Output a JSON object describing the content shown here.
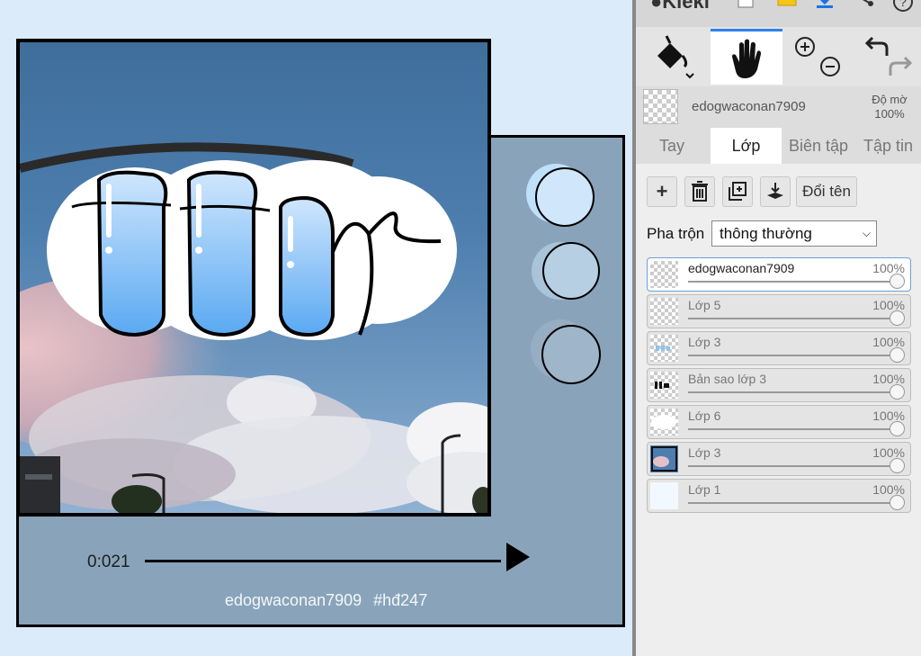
{
  "app": {
    "name": "Kleki"
  },
  "canvas": {
    "timestamp": "0:021",
    "caption": "edogwaconan7909   #hđ247",
    "colors": {
      "background": "#dcebfa",
      "player": "#89a4ba",
      "letter_blue": "#9ccdf6"
    }
  },
  "panel": {
    "current_layer_name": "edogwaconan7909",
    "opacity_label": "Độ mờ",
    "opacity_value": "100%",
    "tabs": [
      "Tay",
      "Lớp",
      "Biên tập",
      "Tập tin"
    ],
    "active_tab": "Lớp",
    "actions": {
      "rename": "Đổi tên"
    },
    "blend": {
      "label": "Pha trộn",
      "value": "thông thường"
    },
    "layers": [
      {
        "name": "edogwaconan7909",
        "opacity": "100%",
        "selected": true
      },
      {
        "name": "Lớp 5",
        "opacity": "100%"
      },
      {
        "name": "Lớp 3",
        "opacity": "100%"
      },
      {
        "name": "Bản sao lớp 3",
        "opacity": "100%"
      },
      {
        "name": "Lớp 6",
        "opacity": "100%"
      },
      {
        "name": "Lớp 3",
        "opacity": "100%"
      },
      {
        "name": "Lớp 1",
        "opacity": "100%"
      }
    ]
  },
  "icons": {
    "top": [
      "kleki-logo-icon",
      "new-file-icon",
      "folder-icon",
      "download-icon",
      "share-icon",
      "help-icon"
    ],
    "tools": [
      "paint-bucket-icon",
      "hand-icon",
      "zoom-in-icon",
      "zoom-out-icon",
      "undo-icon",
      "redo-icon"
    ],
    "layer_actions": [
      "add-layer-icon",
      "delete-layer-icon",
      "duplicate-layer-icon",
      "merge-down-icon"
    ]
  }
}
